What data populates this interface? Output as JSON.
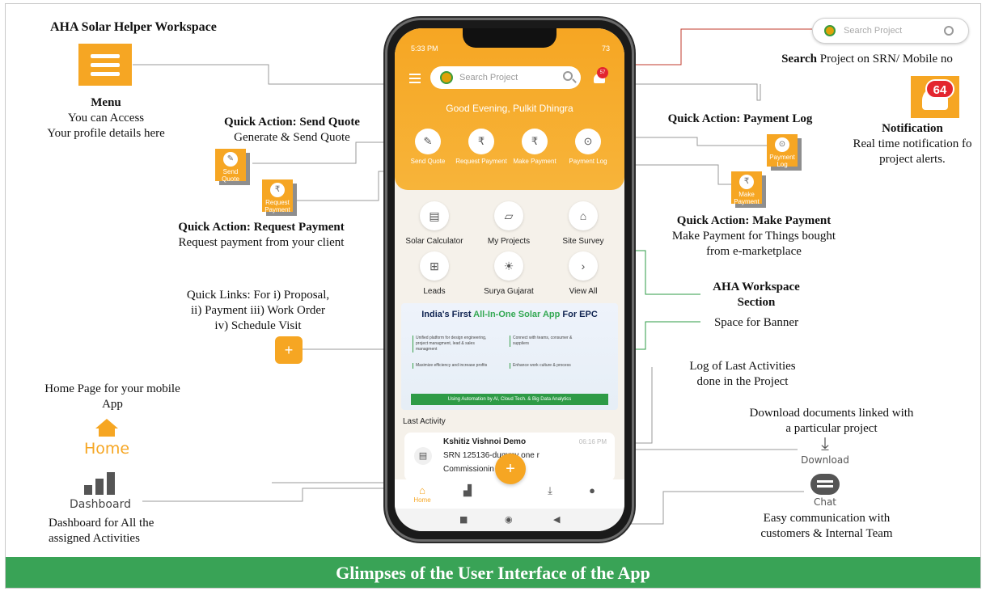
{
  "footer": "Glimpses of the User Interface of the App",
  "annotations": {
    "workspace_title": "AHA  Solar Helper Workspace",
    "menu_title": "Menu",
    "menu_desc": [
      "You can Access",
      "Your profile details here"
    ],
    "send_quote_title": "Quick Action: Send Quote",
    "send_quote_desc": "Generate & Send Quote",
    "request_payment_title": "Quick Action: Request Payment",
    "request_payment_desc": "Request payment from your client",
    "quick_links": [
      "Quick Links: For i) Proposal,",
      "ii) Payment iii) Work Order",
      "iv) Schedule Visit"
    ],
    "home_desc": [
      "Home Page for your mobile",
      "App"
    ],
    "dashboard_desc": [
      "Dashboard for All the",
      "assigned Activities"
    ],
    "search_title": "Search",
    "search_desc": " Project on SRN/ Mobile no",
    "notification_title": "Notification",
    "notification_desc": [
      "Real time notification fo",
      "project alerts."
    ],
    "payment_log_title": "Quick Action: Payment Log",
    "make_payment_title": "Quick Action: Make Payment",
    "make_payment_desc": [
      "Make Payment for Things bought",
      "from e-marketplace"
    ],
    "workspace_section": [
      "AHA  Workspace",
      "Section"
    ],
    "banner_space": "Space for Banner",
    "last_activities": [
      "Log of Last Activities",
      "done in the Project"
    ],
    "download_desc": [
      "Download documents linked with",
      "a particular project"
    ],
    "chat_desc": [
      "Easy communication with",
      "customers & Internal Team"
    ]
  },
  "widgets": {
    "search_placeholder": "Search Project",
    "notif_count": "64",
    "send_quote": [
      "Send",
      "Quote"
    ],
    "request_payment": [
      "Request",
      "Payment"
    ],
    "payment_log": [
      "Payment",
      "Log"
    ],
    "make_payment": [
      "Make",
      "Payment"
    ],
    "home_label": "Home",
    "dashboard_label": "Dashboard",
    "download_label": "Download",
    "chat_label": "Chat"
  },
  "phone": {
    "time": "5:33 PM",
    "battery": "73",
    "search_placeholder": "Search Project",
    "badge": "57",
    "greeting": "Good Evening, Pulkit Dhingra",
    "quick_actions": [
      "Send Quote",
      "Request Payment",
      "Make Payment",
      "Payment Log"
    ],
    "grid": [
      "Solar Calculator",
      "My Projects",
      "Site Survey",
      "Leads",
      "Surya Gujarat",
      "View All"
    ],
    "banner": {
      "title_a": "India's First ",
      "title_b": "All-In-One Solar App",
      "title_c": " For EPC",
      "c1": "Unified platform for design engineering, project managment, lead & sales managment",
      "c2": "Connect with teams, consumer & suppliers",
      "c3": "Maximize efficiency and increase profits",
      "c4": "Enhance work culture & process",
      "bar": "Using Automation by AI, Cloud Tech. & Big Data Analytics"
    },
    "last_activity_title": "Last Activity",
    "activity": {
      "name": "Kshitiz Vishnoi Demo",
      "srn": "SRN 125136-dummy one r",
      "stage": "Commissionin",
      "time": "06:16 PM"
    },
    "nav_home": "Home",
    "fab": "+"
  },
  "colors": {
    "accent": "#f6a623",
    "green": "#39a356",
    "badge": "#e3262f"
  },
  "icons": [
    "menu-icon",
    "search-icon",
    "bell-icon",
    "home-icon",
    "dashboard-icon",
    "download-icon",
    "chat-icon",
    "plus-icon"
  ]
}
